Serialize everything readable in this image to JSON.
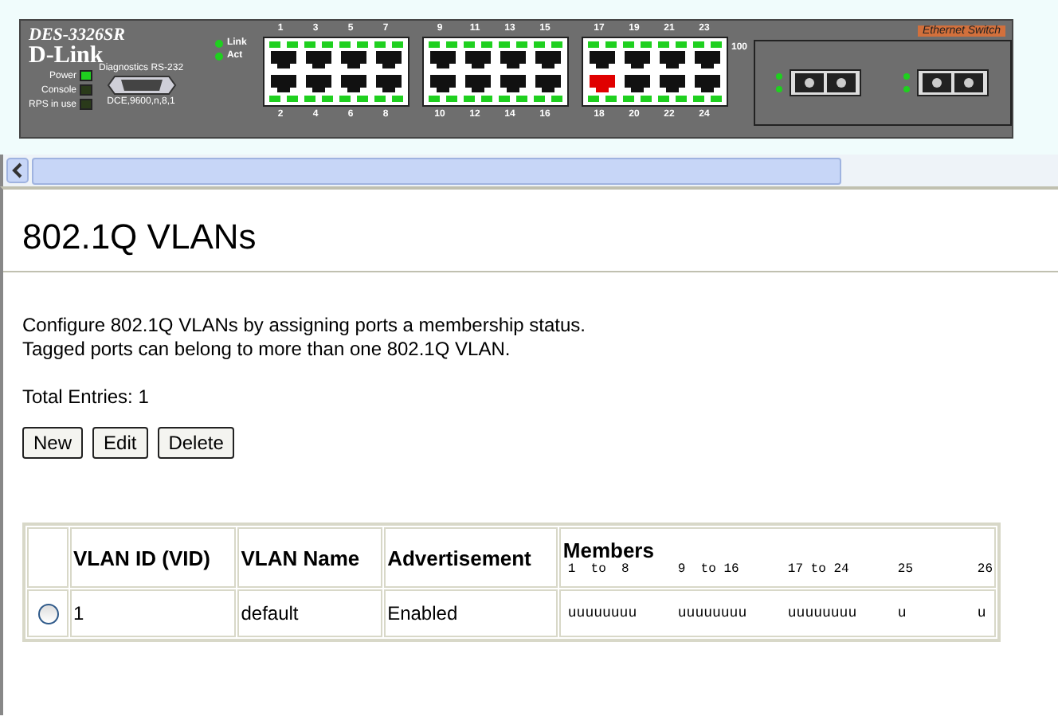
{
  "device": {
    "model": "DES-3326SR",
    "brand": "D-Link",
    "badge": "Ethernet Switch",
    "led_legend": [
      "Link",
      "Act"
    ],
    "status_leds": [
      {
        "label": "Power",
        "on": true
      },
      {
        "label": "Console",
        "on": false
      },
      {
        "label": "RPS in use",
        "on": false
      }
    ],
    "serial": {
      "title": "Diagnostics RS-232",
      "setting": "DCE,9600,n,8,1"
    },
    "speed_label": "100",
    "port_groups": [
      {
        "ports": [
          {
            "label": "1",
            "alert": false
          },
          {
            "label": "2",
            "alert": false
          },
          {
            "label": "3",
            "alert": false
          },
          {
            "label": "4",
            "alert": false
          },
          {
            "label": "5",
            "alert": false
          },
          {
            "label": "6",
            "alert": false
          },
          {
            "label": "7",
            "alert": false
          },
          {
            "label": "8",
            "alert": false
          }
        ]
      },
      {
        "ports": [
          {
            "label": "9",
            "alert": false
          },
          {
            "label": "10",
            "alert": false
          },
          {
            "label": "11",
            "alert": false
          },
          {
            "label": "12",
            "alert": false
          },
          {
            "label": "13",
            "alert": false
          },
          {
            "label": "14",
            "alert": false
          },
          {
            "label": "15",
            "alert": false
          },
          {
            "label": "16",
            "alert": false
          }
        ]
      },
      {
        "ports": [
          {
            "label": "17",
            "alert": false
          },
          {
            "label": "18",
            "alert": true
          },
          {
            "label": "19",
            "alert": false
          },
          {
            "label": "20",
            "alert": false
          },
          {
            "label": "21",
            "alert": false
          },
          {
            "label": "22",
            "alert": false
          },
          {
            "label": "23",
            "alert": false
          },
          {
            "label": "24",
            "alert": false
          }
        ]
      }
    ]
  },
  "page": {
    "title": "802.1Q VLANs",
    "description": [
      "Configure 802.1Q VLANs by assigning ports a membership status.",
      "Tagged ports can belong to more than one 802.1Q VLAN."
    ],
    "total": "Total Entries: 1",
    "buttons": [
      "New",
      "Edit",
      "Delete"
    ]
  },
  "table": {
    "columns": [
      "VLAN ID (VID)",
      "VLAN Name",
      "Advertisement",
      "Members"
    ],
    "member_ranges": [
      "1  to  8",
      "9  to 16",
      "17 to 24",
      "25",
      "26"
    ],
    "rows": [
      {
        "selected": false,
        "vid": "1",
        "name": "default",
        "advertisement": "Enabled",
        "members": [
          "uuuuuuuu",
          "uuuuuuuu",
          "uuuuuuuu",
          "u",
          "u"
        ]
      }
    ]
  }
}
